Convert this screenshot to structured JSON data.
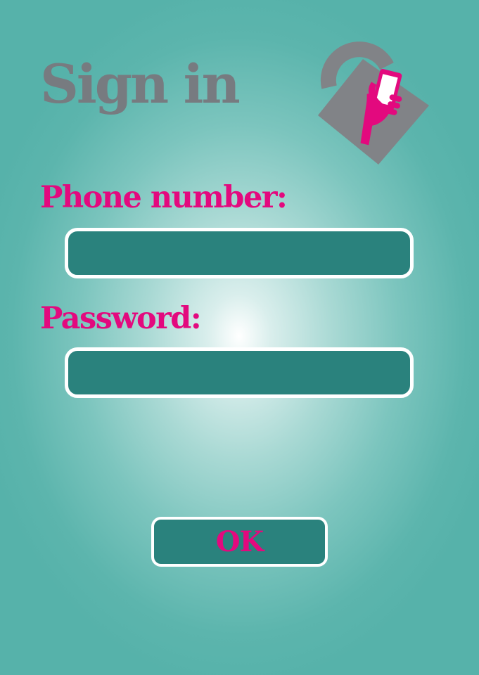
{
  "header": {
    "title": "Sign in",
    "logo_icon": "padlock-phone-icon"
  },
  "form": {
    "phone_label": "Phone number:",
    "phone_value": "",
    "password_label": "Password:",
    "password_value": "",
    "submit_label": "OK"
  },
  "colors": {
    "background": "#56b2aa",
    "title_gray": "#777b80",
    "label_pink": "#e3097e",
    "field_fill": "#2a827d",
    "field_border": "#ffffff"
  }
}
